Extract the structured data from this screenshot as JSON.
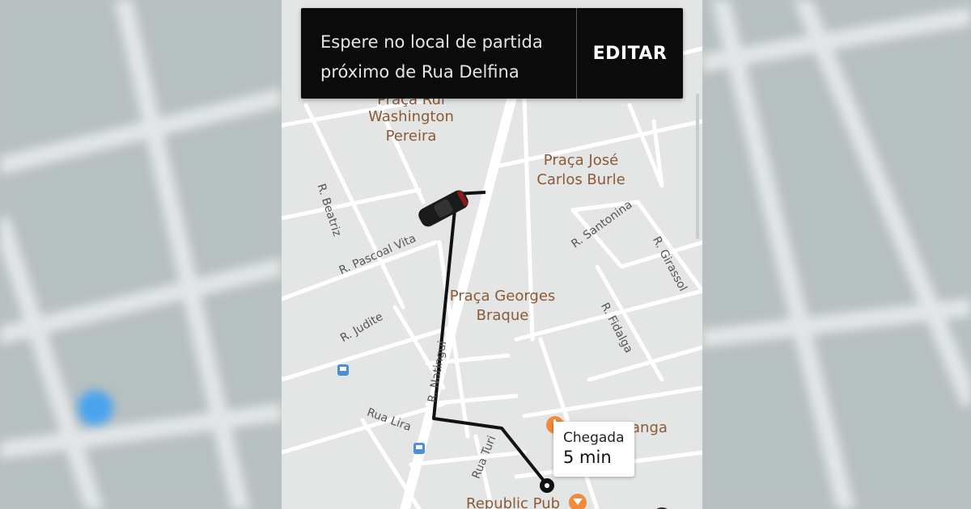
{
  "banner": {
    "line1": "Espere no local de partida",
    "line2": "próximo de Rua Delfina",
    "edit_label": "EDITAR"
  },
  "eta": {
    "label": "Chegada",
    "time": "5 min"
  },
  "places": {
    "praca_rui": "Praça Rui",
    "washington": "Washington",
    "pereira": "Pereira",
    "praca_jose": "Praça José",
    "carlos_burle": "Carlos Burle",
    "praca_georges": "Praça Georges",
    "braque": "Braque",
    "anga": "anga",
    "republic_pub": "Republic Pub"
  },
  "streets": {
    "beatriz": "R. Beatriz",
    "pascoal_vita": "R. Pascoal Vita",
    "judite": "R. Judite",
    "rua_lira": "Rua Lira",
    "natingui": "R. Natingui",
    "rua_turi": "Rua Turi",
    "santonina": "R. Santonina",
    "girassol": "R. Girassol",
    "fidalga": "R. Fidalga"
  },
  "colors": {
    "route": "#111111",
    "poi": "#f08b3c",
    "transit": "#4a90d9",
    "current_location": "#4aa3ee"
  }
}
